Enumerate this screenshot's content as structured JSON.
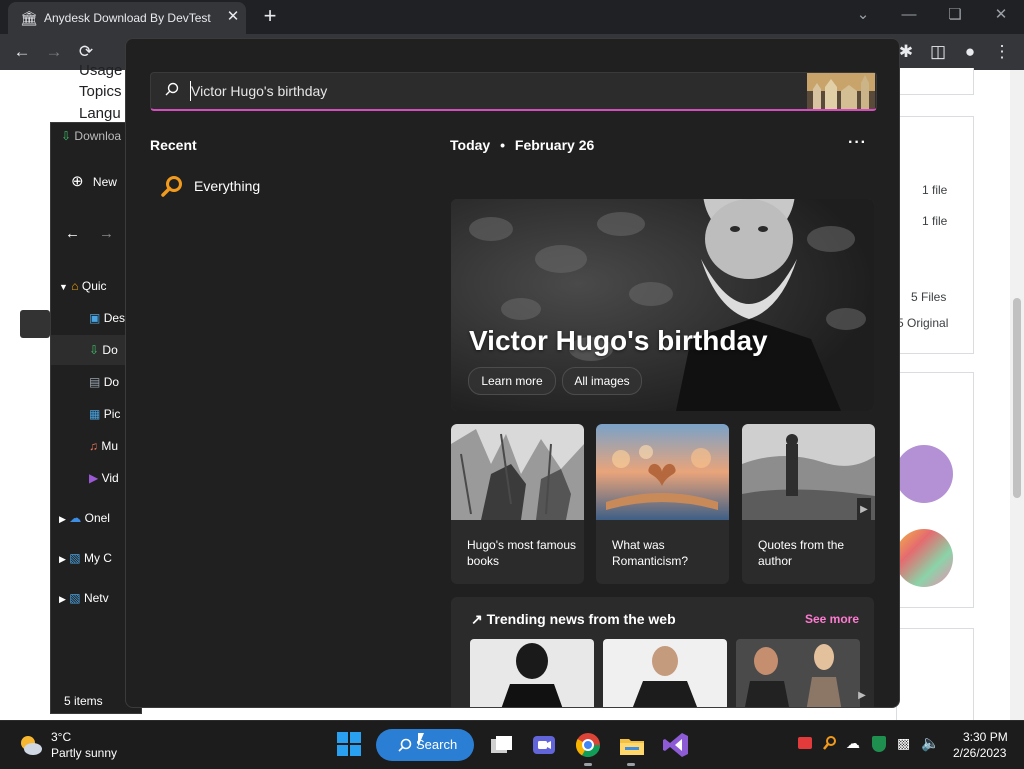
{
  "browser": {
    "tab_title": "Anydesk Download By DevTest :",
    "tab_favicon": "bank-icon",
    "new_tab_label": "+"
  },
  "page": {
    "left_texts": [
      "Usage",
      "Topics",
      "Langu"
    ],
    "right_cards": {
      "file_count_1": "1 file",
      "file_count_2": "1 file",
      "files_total": "5 Files",
      "original": "5 Original"
    }
  },
  "explorer": {
    "title": "Downloa",
    "new_label": "New",
    "quick_access": "Quic",
    "items": [
      "Des",
      "Do",
      "Do",
      "Pic",
      "Mu",
      "Vid"
    ],
    "onedrive": "Onel",
    "mypc": "My C",
    "network": "Netv",
    "status": "5 items"
  },
  "search": {
    "query": "Victor Hugo's birthday",
    "recent_heading": "Recent",
    "recent_items": [
      "Everything"
    ],
    "today_label": "Today",
    "date_label": "February 26",
    "more_label": "···",
    "hero": {
      "title": "Victor Hugo's birthday",
      "learn_more": "Learn more",
      "all_images": "All images"
    },
    "cards": [
      {
        "label": "Hugo's most famous books"
      },
      {
        "label": "What was Romanticism?"
      },
      {
        "label": "Quotes from the author"
      }
    ],
    "trending": {
      "title": "Trending news from the web",
      "see_more": "See more"
    }
  },
  "taskbar": {
    "weather_temp": "3°C",
    "weather_desc": "Partly sunny",
    "search_label": "Search",
    "time": "3:30 PM",
    "date": "2/26/2023"
  },
  "colors": {
    "accent_pink": "#d44fbe",
    "see_more_pink": "#ff7ad1",
    "taskbar_search_blue": "#2a7fd4"
  }
}
